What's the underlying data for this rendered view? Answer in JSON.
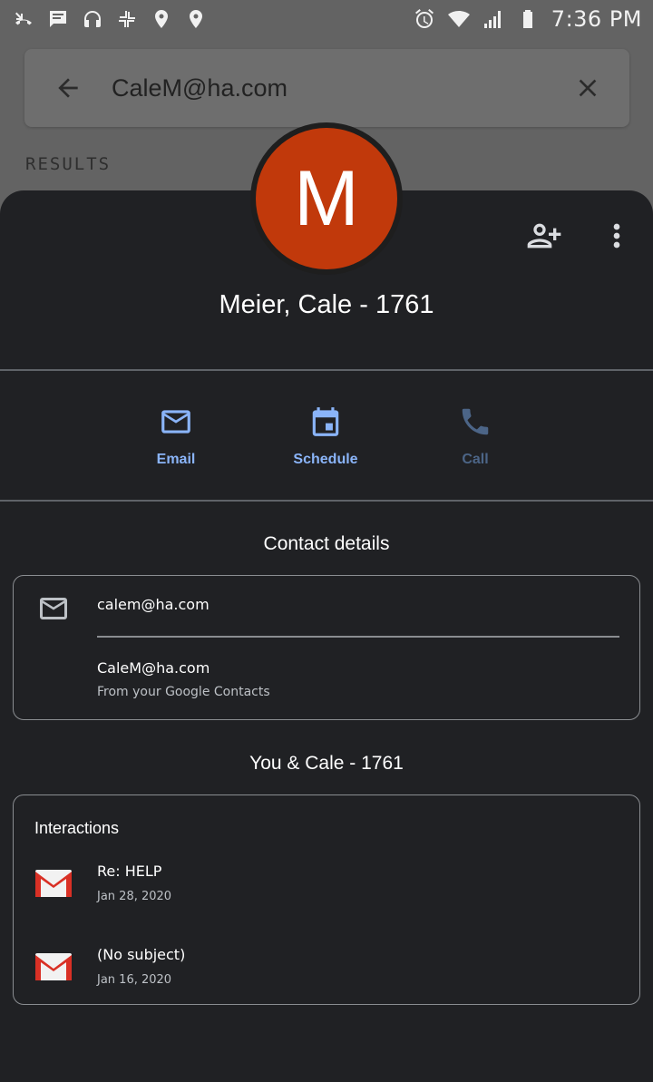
{
  "status_bar": {
    "time": "7:36 PM",
    "left_icons": [
      "missed-call-icon",
      "message-icon",
      "headphones-icon",
      "pinwheel-icon",
      "location-icon",
      "location-icon"
    ],
    "right_icons": [
      "alarm-icon",
      "wifi-icon",
      "signal-icon",
      "battery-icon"
    ]
  },
  "search": {
    "query": "CaleM@ha.com",
    "results_label": "RESULTS"
  },
  "contact": {
    "avatar_letter": "M",
    "avatar_color": "#c1390b",
    "name": "Meier, Cale - 1761"
  },
  "quick_actions": {
    "email_label": "Email",
    "schedule_label": "Schedule",
    "call_label": "Call"
  },
  "contact_details": {
    "title": "Contact details",
    "primary_email": "calem@ha.com",
    "secondary_email": "CaleM@ha.com",
    "source": "From your Google Contacts"
  },
  "relationship": {
    "title": "You & Cale - 1761",
    "interactions_heading": "Interactions",
    "items": [
      {
        "subject": "Re: HELP",
        "date": "Jan 28, 2020"
      },
      {
        "subject": "(No subject)",
        "date": "Jan 16, 2020"
      }
    ]
  },
  "colors": {
    "accent": "#8ab4f8",
    "disabled_accent": "#4c6587",
    "sheet_background": "#202124"
  }
}
